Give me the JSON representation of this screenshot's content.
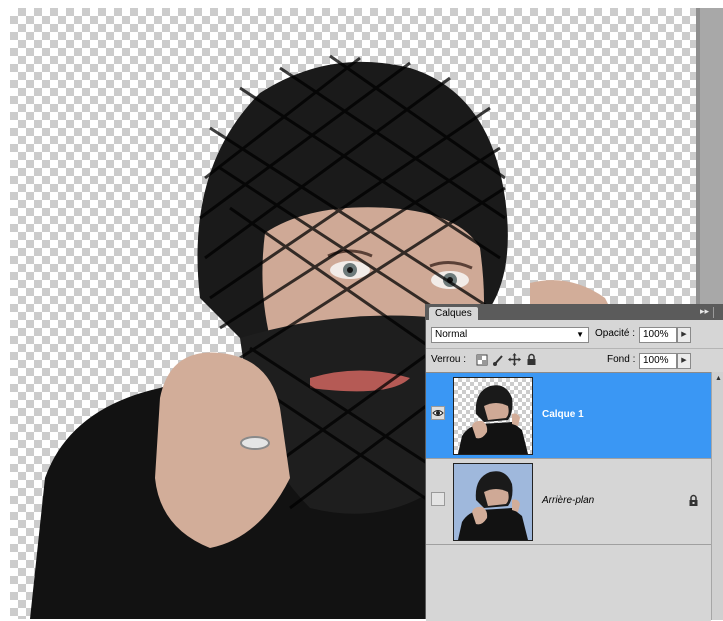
{
  "panel": {
    "tab_title": "Calques",
    "menu_glyph": "▸▸",
    "blend_mode": "Normal",
    "opacity_label": "Opacité :",
    "opacity_value": "100%",
    "lock_label": "Verrou :",
    "fill_label": "Fond :",
    "fill_value": "100%"
  },
  "layers": [
    {
      "name": "Calque 1",
      "active": true,
      "visible": true,
      "icon": "eye-icon"
    },
    {
      "name": "Arrière-plan",
      "active": false,
      "visible": false,
      "locked": true,
      "icon": "lock-icon"
    }
  ],
  "colors": {
    "selection": "#3a97f4",
    "panel_bg": "#d6d6d6",
    "panel_titlebar": "#5b5b5b"
  }
}
